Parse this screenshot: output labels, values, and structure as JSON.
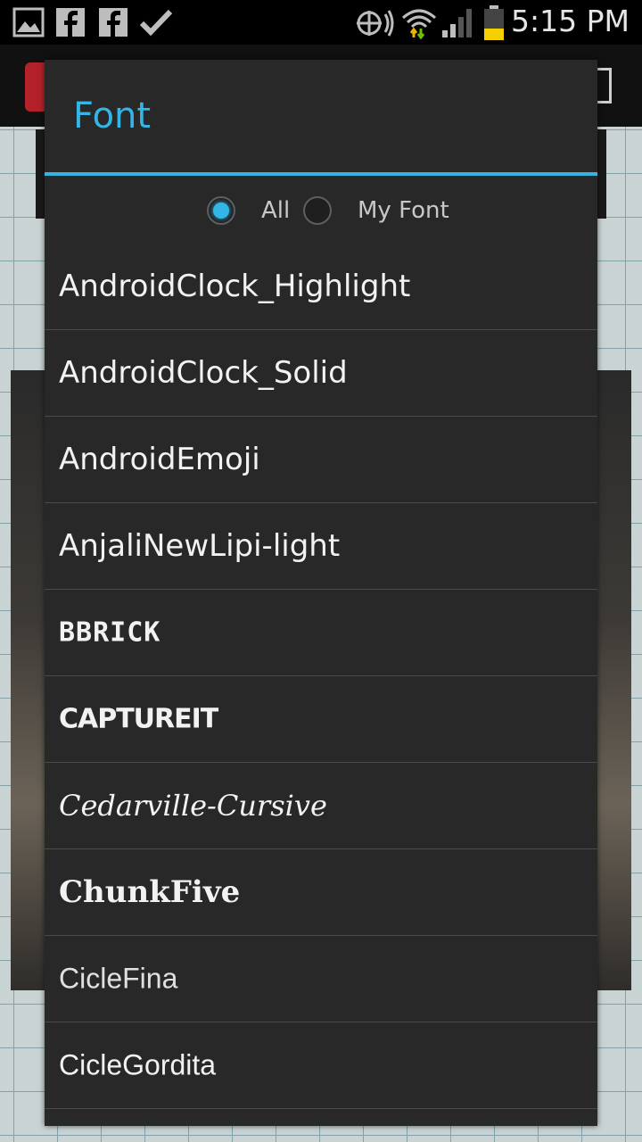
{
  "status_bar": {
    "time": "5:15 PM",
    "icons": [
      "gallery-icon",
      "facebook-icon",
      "facebook-icon",
      "check-icon",
      "gps-icon",
      "wifi-icon",
      "signal-icon",
      "battery-icon"
    ]
  },
  "dialog": {
    "title": "Font",
    "filter": {
      "all_label": "All",
      "my_font_label": "My Font",
      "selected": "All"
    },
    "fonts": [
      "AndroidClock_Highlight",
      "AndroidClock_Solid",
      "AndroidEmoji",
      "AnjaliNewLipi-light",
      "BBRICK",
      "CAPTUREIT",
      "Cedarville-Cursive",
      "ChunkFive",
      "CicleFina",
      "CicleGordita"
    ]
  },
  "colors": {
    "accent": "#33b5e5",
    "dialog_bg": "#282828",
    "divider": "#4a4a4a"
  }
}
